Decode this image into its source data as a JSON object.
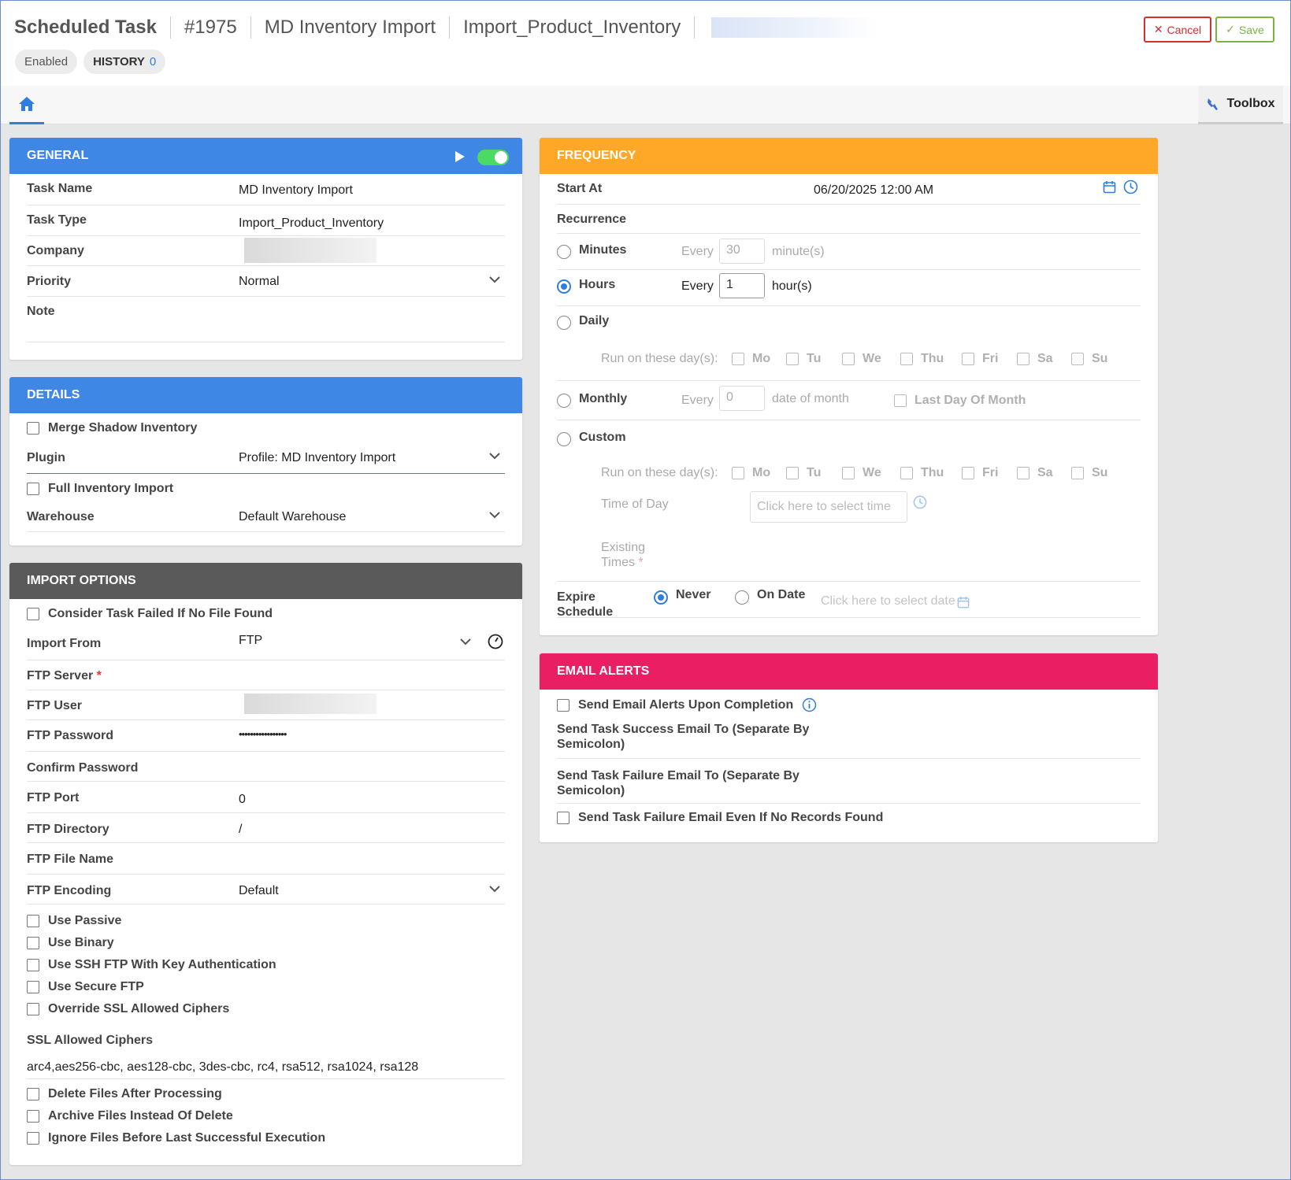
{
  "header": {
    "title": "Scheduled Task",
    "id": "#1975",
    "task_name": "MD Inventory Import",
    "task_type": "Import_Product_Inventory",
    "status_badge": "Enabled",
    "history_label": "HISTORY",
    "history_count": "0",
    "cancel_label": "Cancel",
    "save_label": "Save"
  },
  "tabs": {
    "toolbox_label": "Toolbox"
  },
  "general": {
    "title": "GENERAL",
    "task_name_label": "Task Name",
    "task_name_value": "MD Inventory Import",
    "task_type_label": "Task Type",
    "task_type_value": "Import_Product_Inventory",
    "company_label": "Company",
    "priority_label": "Priority",
    "priority_value": "Normal",
    "note_label": "Note"
  },
  "details": {
    "title": "DETAILS",
    "merge_label": "Merge Shadow Inventory",
    "plugin_label": "Plugin",
    "plugin_value": "Profile: MD Inventory Import",
    "full_import_label": "Full Inventory Import",
    "warehouse_label": "Warehouse",
    "warehouse_value": "Default Warehouse"
  },
  "import_options": {
    "title": "IMPORT OPTIONS",
    "consider_failed_label": "Consider Task Failed If No File Found",
    "import_from_label": "Import From",
    "import_from_value": "FTP",
    "ftp_server_label": "FTP Server",
    "required_mark": "*",
    "ftp_user_label": "FTP User",
    "ftp_password_label": "FTP Password",
    "ftp_password_value": "•••••••••••••••••",
    "confirm_password_label": "Confirm Password",
    "ftp_port_label": "FTP Port",
    "ftp_port_value": "0",
    "ftp_directory_label": "FTP Directory",
    "ftp_directory_value": "/",
    "ftp_file_name_label": "FTP File Name",
    "ftp_encoding_label": "FTP Encoding",
    "ftp_encoding_value": "Default",
    "use_passive_label": "Use Passive",
    "use_binary_label": "Use Binary",
    "use_ssh_label": "Use SSH FTP With Key Authentication",
    "use_secure_label": "Use Secure FTP",
    "override_ssl_label": "Override SSL Allowed Ciphers",
    "ssl_ciphers_label": "SSL Allowed Ciphers",
    "ssl_ciphers_value": "arc4,aes256-cbc, aes128-cbc, 3des-cbc, rc4, rsa512, rsa1024, rsa128",
    "delete_files_label": "Delete Files After Processing",
    "archive_files_label": "Archive Files Instead Of Delete",
    "ignore_files_label": "Ignore Files Before Last Successful Execution"
  },
  "frequency": {
    "title": "FREQUENCY",
    "start_at_label": "Start At",
    "start_at_value": "06/20/2025 12:00 AM",
    "recurrence_label": "Recurrence",
    "minutes_label": "Minutes",
    "every_label": "Every",
    "minutes_value": "30",
    "minutes_unit": "minute(s)",
    "hours_label": "Hours",
    "hours_value": "1",
    "hours_unit": "hour(s)",
    "daily_label": "Daily",
    "run_on_days_label": "Run on these day(s):",
    "days": [
      "Mo",
      "Tu",
      "We",
      "Thu",
      "Fri",
      "Sa",
      "Su"
    ],
    "monthly_label": "Monthly",
    "monthly_value": "0",
    "date_of_month_label": "date of month",
    "last_day_label": "Last Day Of Month",
    "custom_label": "Custom",
    "time_of_day_label": "Time of Day",
    "time_placeholder": "Click here to select time",
    "existing_times_label_1": "Existing",
    "existing_times_label_2": "Times",
    "expire_label_1": "Expire",
    "expire_label_2": "Schedule",
    "never_label": "Never",
    "on_date_label": "On Date",
    "date_placeholder": "Click here to select date"
  },
  "email_alerts": {
    "title": "EMAIL ALERTS",
    "send_alerts_label": "Send Email Alerts Upon Completion",
    "success_label_1": "Send Task Success Email To (Separate By",
    "success_label_2": "Semicolon)",
    "failure_label_1": "Send Task Failure Email To (Separate By",
    "failure_label_2": "Semicolon)",
    "failure_no_records_label": "Send Task Failure Email Even If No Records Found"
  },
  "colors": {
    "blue": "#3f87e5",
    "dark": "#5a5a5a",
    "orange": "#ffa726",
    "pink": "#e91e63"
  }
}
